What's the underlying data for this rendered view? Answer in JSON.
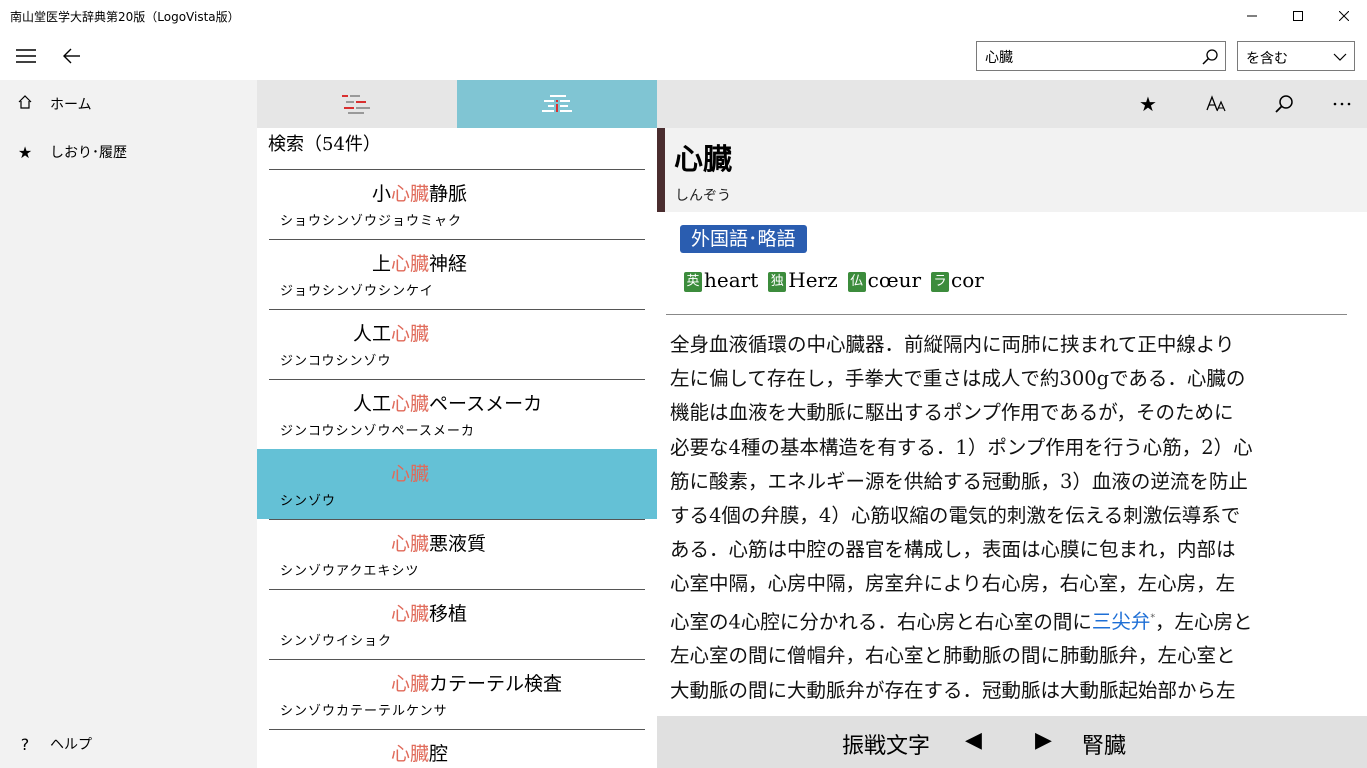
{
  "window": {
    "title": "南山堂医学大辞典第20版（LogoVista版）",
    "minimize_icon": "minimize-icon",
    "maximize_icon": "maximize-icon",
    "close_icon": "close-icon"
  },
  "appbar": {
    "search_value": "心臓",
    "match_mode": "を含む"
  },
  "nav": {
    "items": [
      {
        "icon": "home-icon",
        "label": "ホーム"
      },
      {
        "icon": "star-icon",
        "label": "しおり･履歴"
      }
    ],
    "help": {
      "icon": "help-icon",
      "glyph": "?",
      "label": "ヘルプ"
    }
  },
  "results": {
    "count_label": "検索（54件）",
    "highlight_color": "#e06a5a",
    "selected_color": "#64c1d6",
    "rows": [
      {
        "pre": "小",
        "hit": "心臓",
        "post": "静脈",
        "reading": "ショウシンゾウジョウミャク"
      },
      {
        "pre": "上",
        "hit": "心臓",
        "post": "神経",
        "reading": "ジョウシンゾウシンケイ"
      },
      {
        "pre": "人工",
        "hit": "心臓",
        "post": "",
        "reading": "ジンコウシンゾウ"
      },
      {
        "pre": "人工",
        "hit": "心臓",
        "post": "ペースメーカ",
        "reading": "ジンコウシンゾウペースメーカ"
      },
      {
        "pre": "",
        "hit": "心臓",
        "post": "",
        "reading": "シンゾウ",
        "selected": true
      },
      {
        "pre": "",
        "hit": "心臓",
        "post": "悪液質",
        "reading": "シンゾウアクエキシツ"
      },
      {
        "pre": "",
        "hit": "心臓",
        "post": "移植",
        "reading": "シンゾウイショク"
      },
      {
        "pre": "",
        "hit": "心臓",
        "post": "カテーテル検査",
        "reading": "シンゾウカテーテルケンサ"
      },
      {
        "pre": "",
        "hit": "心臓",
        "post": "腔",
        "reading": ""
      }
    ]
  },
  "entry": {
    "headword": "心臓",
    "kana": "しんぞう",
    "section_label": "外国語･略語",
    "foreign": [
      {
        "tag": "英",
        "word": "heart"
      },
      {
        "tag": "独",
        "word": "Herz"
      },
      {
        "tag": "仏",
        "word": "cœur"
      },
      {
        "tag": "ラ",
        "word": "cor"
      }
    ],
    "body_lines": [
      "全身血液循環の中心臓器．前縦隔内に両肺に挟まれて正中線より",
      "左に偏して存在し，手拳大で重さは成人で約300gである．心臓の",
      "機能は血液を大動脈に駆出するポンプ作用であるが，そのために",
      "必要な4種の基本構造を有する．1）ポンプ作用を行う心筋，2）心",
      "筋に酸素，エネルギー源を供給する冠動脈，3）血液の逆流を防止",
      "する4個の弁膜，4）心筋収縮の電気的刺激を伝える刺激伝導系で",
      "ある．心筋は中腔の器官を構成し，表面は心膜に包まれ，内部は",
      "心室中隔，心房中隔，房室弁により右心房，右心室，左心房，左"
    ],
    "line9_pre": "心室の4心腔に分かれる．右心房と右心室の間に",
    "line9_link": "三尖弁",
    "line9_mark": "*",
    "line9_post": "，左心房と",
    "body_lines_after": [
      "左心室の間に僧帽弁，右心室と肺動脈の間に肺動脈弁，左心室と",
      "大動脈の間に大動脈弁が存在する．冠動脈は大動脈起始部から左"
    ],
    "link_color": "#1e6fd6"
  },
  "footer": {
    "prev_label": "振戦文字",
    "prev_glyph": "◀",
    "next_glyph": "▶",
    "next_label": "腎臓"
  }
}
